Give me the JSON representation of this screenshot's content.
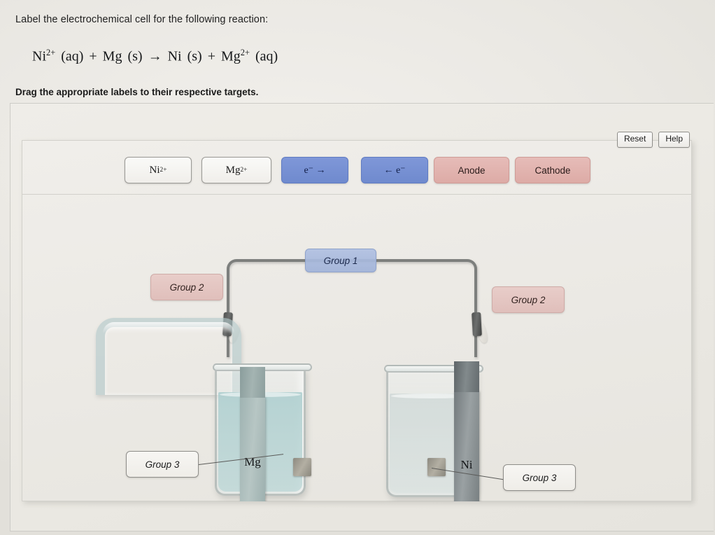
{
  "question": {
    "stem": "Label the electrochemical cell for the following reaction:",
    "equation_plain": "Ni2+ (aq) + Mg (s) → Ni (s) + Mg2+ (aq)",
    "equation_parts": {
      "r1_symbol": "Ni",
      "r1_charge": "2+",
      "r1_state": "(aq)",
      "plus1": "+",
      "r2_symbol": "Mg",
      "r2_state": "(s)",
      "arrow": "→",
      "p1_symbol": "Ni",
      "p1_state": "(s)",
      "plus2": "+",
      "p2_symbol": "Mg",
      "p2_charge": "2+",
      "p2_state": "(aq)"
    },
    "instruction": "Drag the appropriate labels to their respective targets."
  },
  "toolbar": {
    "reset_label": "Reset",
    "help_label": "Help"
  },
  "tiles": [
    {
      "id": "ni-ion",
      "symbol": "Ni",
      "charge": "2+",
      "text": "Ni2+",
      "style": "plain"
    },
    {
      "id": "mg-ion",
      "symbol": "Mg",
      "charge": "2+",
      "text": "Mg2+",
      "style": "plain"
    },
    {
      "id": "e-forward",
      "text": "e⁻ →",
      "style": "blue"
    },
    {
      "id": "e-reverse",
      "text": "← e⁻",
      "style": "blue"
    },
    {
      "id": "anode",
      "text": "Anode",
      "style": "pink"
    },
    {
      "id": "cathode",
      "text": "Cathode",
      "style": "pink"
    }
  ],
  "targets": [
    {
      "id": "group1",
      "label": "Group 1",
      "style": "blue",
      "position": "wire-top"
    },
    {
      "id": "group2-left",
      "label": "Group 2",
      "style": "pink",
      "position": "left-electrode"
    },
    {
      "id": "group2-right",
      "label": "Group 2",
      "style": "pink",
      "position": "right-electrode"
    },
    {
      "id": "group3-left",
      "label": "Group 3",
      "style": "neutral",
      "position": "left-solution"
    },
    {
      "id": "group3-right",
      "label": "Group 3",
      "style": "neutral",
      "position": "right-solution"
    }
  ],
  "apparatus": {
    "left_electrode_label": "Mg",
    "right_electrode_label": "Ni",
    "left_solution_color": "#a8cccd",
    "right_solution_color": "#cdd7d6",
    "wire_color": "#7d7f7d",
    "salt_bridge_color": "#b2c8ca"
  },
  "colors": {
    "page_background": "#ebe9e4",
    "tile_blue": "#7f97d8",
    "tile_pink": "#e6bcb8",
    "target_blue": "#b0c0e2",
    "target_pink": "#e8cdc9",
    "panel_border": "#cdccc7"
  }
}
